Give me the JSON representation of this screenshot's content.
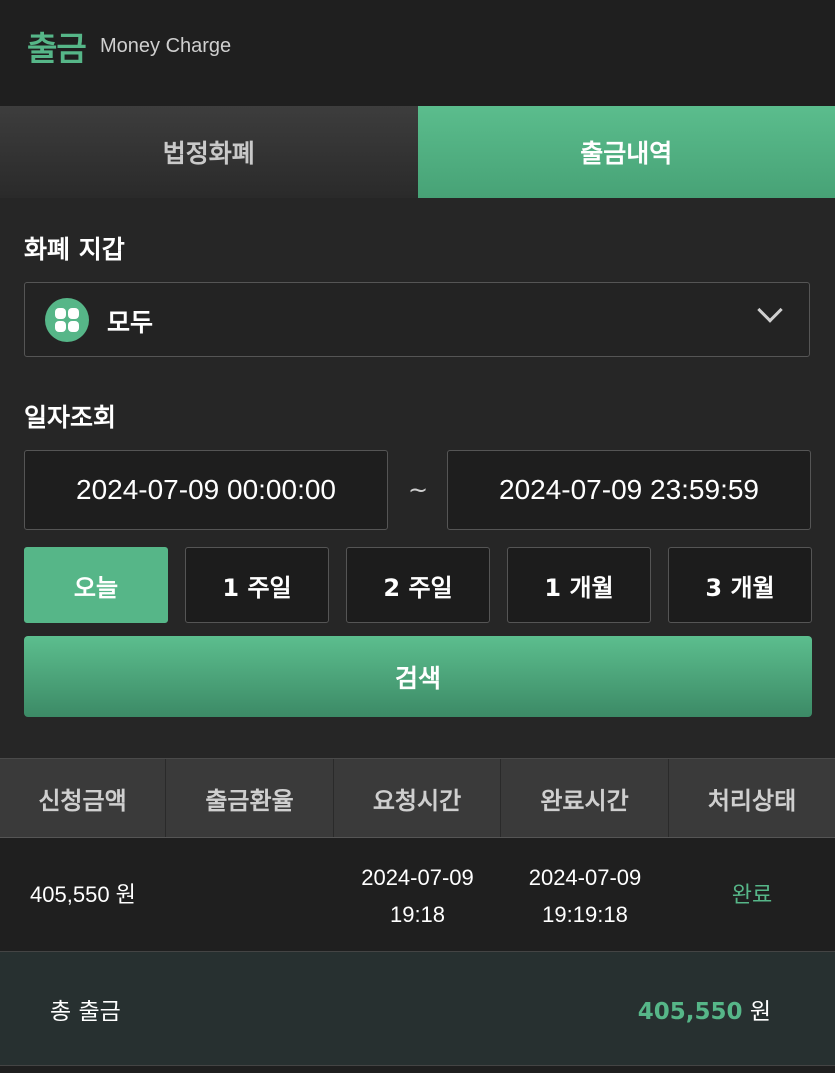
{
  "header": {
    "title": "출금",
    "subtitle": "Money Charge"
  },
  "tabs": [
    {
      "label": "법정화폐",
      "active": false
    },
    {
      "label": "출금내역",
      "active": true
    }
  ],
  "wallet": {
    "label": "화폐 지갑",
    "selected": "모두",
    "icon": "grid-four-icon"
  },
  "date_query": {
    "label": "일자조회",
    "start": "2024-07-09 00:00:00",
    "separator": "~",
    "end": "2024-07-09 23:59:59"
  },
  "ranges": [
    "오늘",
    "1 주일",
    "2 주일",
    "1 개월",
    "3 개월"
  ],
  "selected_range": "오늘",
  "search_label": "검색",
  "table": {
    "headers": [
      "신청금액",
      "출금환율",
      "요청시간",
      "완료시간",
      "처리상태"
    ],
    "rows": [
      {
        "amount": "405,550 원",
        "rate": "",
        "request_date": "2024-07-09",
        "request_time": "19:18",
        "complete_date": "2024-07-09",
        "complete_time": "19:19:18",
        "status": "완료"
      }
    ]
  },
  "total": {
    "label": "총 출금",
    "amount": "405,550",
    "unit": "원"
  },
  "colors": {
    "accent": "#56b688",
    "background": "#1f1f1f",
    "panel": "#262626"
  }
}
